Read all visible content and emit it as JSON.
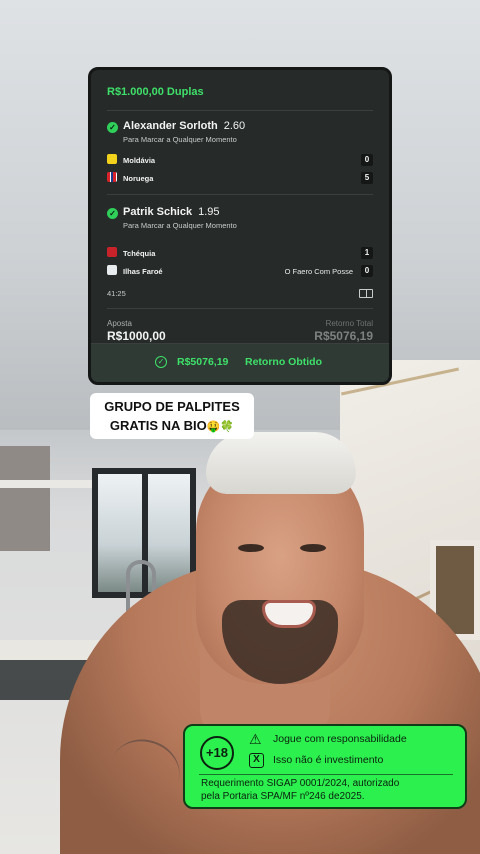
{
  "bet_card": {
    "title": "R$1.000,00 Duplas",
    "selections": [
      {
        "player": "Alexander Sorloth",
        "odds": "2.60",
        "market": "Para Marcar a Qualquer Momento",
        "teams": [
          {
            "name": "Moldávia",
            "score": "0"
          },
          {
            "name": "Noruega",
            "score": "5"
          }
        ]
      },
      {
        "player": "Patrik Schick",
        "odds": "1.95",
        "market": "Para Marcar a Qualquer Momento",
        "teams": [
          {
            "name": "Tchéquia",
            "score": "1"
          },
          {
            "name": "Ilhas Faroé",
            "score": "0",
            "note": "O Faero Com Posse"
          }
        ],
        "time": "41:25"
      }
    ],
    "stake_label": "Aposta",
    "stake_value": "R$1000,00",
    "return_label": "Retorno Total",
    "return_value": "R$5076,19",
    "footer_value": "R$5076,19",
    "footer_label": "Retorno Obtido"
  },
  "caption": {
    "line1": "GRUPO DE PALPITES",
    "line2": "GRATIS NA BIO",
    "emoji": "🤑🍀"
  },
  "badge": {
    "age": "+18",
    "line1": "Jogue com responsabilidade",
    "line2": "Isso não é investimento",
    "line3": "Requerimento SIGAP 0001/2024, autorizado",
    "line4": "pela Portaria SPA/MF nº246 de2025."
  },
  "colors": {
    "accent_green": "#3fe06a",
    "badge_green": "#2bf04d",
    "card_bg": "#262a28"
  }
}
